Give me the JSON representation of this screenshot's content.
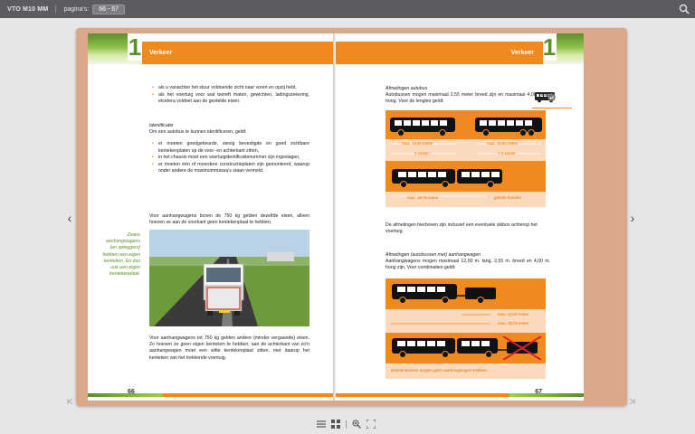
{
  "topbar": {
    "title": "VTO M10 MM",
    "page_label": "pagina's:",
    "page_value": "66 - 67"
  },
  "left_page": {
    "header": "Verkeer",
    "chapter_number": "1",
    "page_number": "66",
    "bullets_top": [
      "als u vanachter het stuur voldoende zicht naar voren en opzij hebt,",
      "als het voertuig voor wat betreft maten, gewichten, ladingszekering, etcetera voldoet aan de gestelde eisen."
    ],
    "identification_heading": "Identificatie",
    "identification_intro": "Om een autobus te kunnen identificeren, geldt:",
    "bullets_id": [
      "er moeten goedgekeurde, stevig bevestigde en goed zichtbare kentekenplaten op de voor- en achterkant zitten,",
      "in het chassis moet een voertuigidentificatienummer zijn ingeslagen,",
      "er moeten één of meerdere constructieplaten zijn gemonteerd, waarop onder andere de maximummassa's staan vermeld."
    ],
    "trailer_text": "Voor aanhangwagens boven de 750 kg gelden dezelfde eisen, alleen hoeven ze aan de voorkant geen kentekenplaat te hebben.",
    "side_note": "Zware aanhangwagens (en opleggers) hebben een eigen kenteken. En dus ook een eigen kentekenplaat.",
    "bottom_text": "Voor aanhangwagens tot 750 kg gelden andere (minder vergaande) eisen. Zo hoeven ze geen eigen kenteken te hebben; aan de achterkant van zo'n aanhangwagen moet een witte kentekenplaat zitten, met daarop het kenteken van het trekkende voertuig."
  },
  "right_page": {
    "header": "Verkeer",
    "chapter_number": "1",
    "page_number": "67",
    "section1_heading": "Afmetingen autobus",
    "section1_text": "Autobussen mogen maximaal 2,55 meter breed zijn en maximaal 4,00 meter hoog. Voor de lengtes geldt:",
    "diagram1": {
      "label_a": "max. 13,50 meter",
      "label_b": "max. 15,00 meter",
      "label_c": "2 assen",
      "label_d": "> 2 assen",
      "label_e": "max. 18,75 meter",
      "label_f": "gelede bussen"
    },
    "section1_note": "De afmetingen hierboven zijn inclusief een eventuele skibox achterop het voertuig.",
    "section2_heading": "Afmetingen (autobussen met) aanhangwagen",
    "section2_text": "Aanhangwagens mogen maximaal 12,00 m. lang, 2,55 m. breed en 4,00 m. hoog zijn. Voor combinaties geldt:",
    "diagram2": {
      "label_a": "max. 12,00 meter",
      "label_b": "max. 18,75 meter",
      "caption": "Gelede bussen mogen geen aanhangwagen trekken."
    }
  },
  "colors": {
    "accent": "#f08a1e",
    "green": "#5b8f2a",
    "light_orange": "#fbd9bc",
    "topbar": "#5a5c5f"
  },
  "icons": [
    "search-icon",
    "chevron-left-icon",
    "chevron-right-icon",
    "list-view-icon",
    "grid-view-icon",
    "zoom-in-icon",
    "fullscreen-icon",
    "bus-icon",
    "return-icon"
  ]
}
